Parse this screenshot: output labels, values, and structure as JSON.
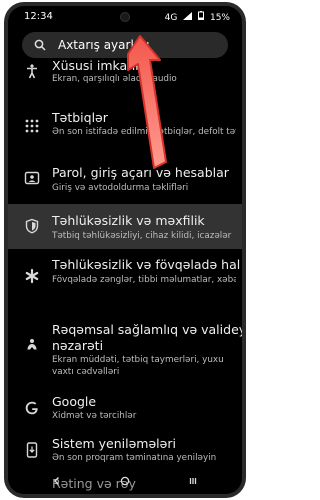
{
  "status": {
    "time": "12:34",
    "network": "4G",
    "battery": "15%"
  },
  "search": {
    "placeholder": "Axtarış ayarları"
  },
  "items": [
    {
      "title": "Xüsusi imkanlar",
      "subtitle": "Ekran, qarşılıqlı əlaqə, audio"
    },
    {
      "title": "Tətbiqlər",
      "subtitle": "Ən son istifadə edilmiş tətbiqlər, defolt tətbiqlər"
    },
    {
      "title": "Parol, giriş açarı və hesablar",
      "subtitle": "Giriş və avtodoldurma təklifləri"
    },
    {
      "title": "Təhlükəsizlik və məxfilik",
      "subtitle": "Tətbiq təhlükəsizliyi, cihaz kilidi, icazələr"
    },
    {
      "title": "Təhlükəsizlik və fövqəladə hal",
      "subtitle": "Fövqəladə zənglər, tibbi məlumatlar, xəbərdarlıqlar"
    },
    {
      "title": "Rəqəmsal sağlamlıq və valideyn nəzarəti",
      "title_line1": "Rəqəmsal sağlamlıq və valideyn",
      "title_line2": "nəzarəti",
      "subtitle_line1": "Ekran müddəti, tətbiq taymerləri, yuxu",
      "subtitle_line2": "vaxtı cədvəlləri"
    },
    {
      "title": "Google",
      "subtitle": "Xidmət və tərcihlər"
    },
    {
      "title": "Sistem yeniləmələri",
      "subtitle": "Ən son proqram təminatına yeniləyin"
    },
    {
      "title": "Rəting və rəy"
    }
  ],
  "icons": {
    "search": "search-icon",
    "accessibility": "accessibility-icon",
    "apps": "apps-grid-icon",
    "passwords": "account-card-icon",
    "security": "shield-icon",
    "emergency": "asterisk-icon",
    "wellbeing": "wellbeing-icon",
    "google": "google-icon",
    "update": "phone-update-icon"
  },
  "colors": {
    "background": "#000000",
    "highlight": "#333333",
    "arrow": "#e8423a"
  }
}
